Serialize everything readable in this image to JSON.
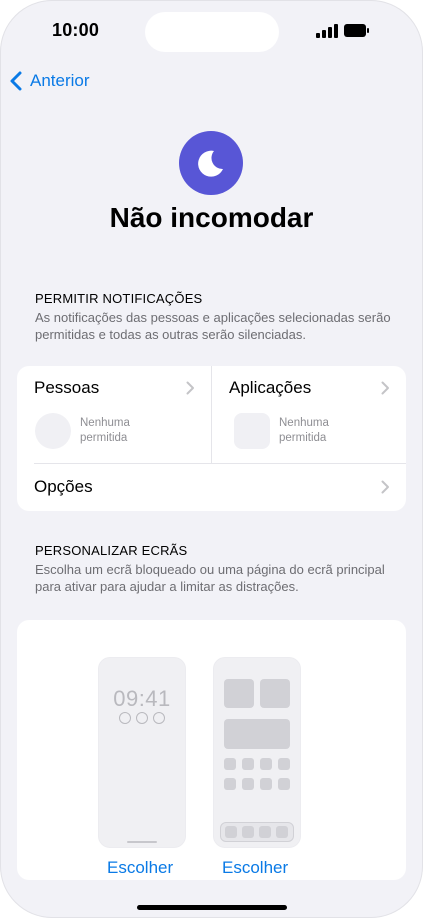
{
  "status_bar": {
    "time": "10:00"
  },
  "nav": {
    "back_label": "Anterior"
  },
  "header": {
    "icon": "moon-icon",
    "title": "Não incomodar",
    "accent_color": "#5856d6"
  },
  "notifications": {
    "section_title": "PERMITIR NOTIFICAÇÕES",
    "description": "As notificações das pessoas e aplicações selecionadas serão permitidas e todas as outras serão silenciadas.",
    "people": {
      "label": "Pessoas",
      "status": "Nenhuma permitida"
    },
    "apps": {
      "label": "Aplicações",
      "status": "Nenhuma permitida"
    },
    "options_label": "Opções"
  },
  "screens": {
    "section_title": "PERSONALIZAR ECRÃS",
    "description": "Escolha um ecrã bloqueado ou uma página do ecrã principal para ativar para ajudar a limitar as distrações.",
    "lock_screen_time": "09:41",
    "choose_lock_label": "Escolher",
    "choose_home_label": "Escolher"
  },
  "colors": {
    "link": "#0a7ae6",
    "background": "#f2f2f7"
  }
}
